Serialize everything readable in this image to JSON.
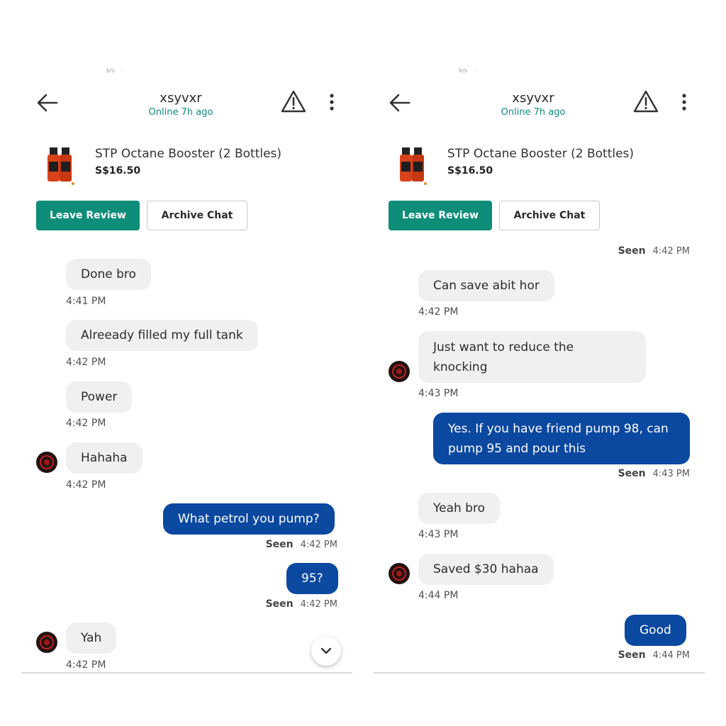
{
  "header": {
    "contact_name": "xsyvxr",
    "status": "Online 7h ago"
  },
  "listing": {
    "name": "STP Octane Booster (2 Bottles)",
    "price": "S$16.50"
  },
  "actions": {
    "leave_review": "Leave Review",
    "archive_chat": "Archive Chat"
  },
  "icons": {
    "back": "arrow-left-icon",
    "report": "warning-triangle-icon",
    "menu": "more-vertical-icon",
    "scroll": "chevron-down-icon"
  },
  "colors": {
    "accent_green": "#0e8e79",
    "outgoing_bubble": "#0b48a0",
    "incoming_bubble": "#f0f0f0"
  },
  "left_panel": {
    "messages": [
      {
        "dir": "in",
        "text": "Done bro",
        "time": "4:41 PM"
      },
      {
        "dir": "in",
        "text": "Alreeady filled my full tank",
        "time": "4:42 PM"
      },
      {
        "dir": "in",
        "text": "Power",
        "time": "4:42 PM"
      },
      {
        "dir": "in",
        "text": "Hahaha",
        "time": "4:42 PM"
      },
      {
        "dir": "out",
        "text": "What petrol you pump?",
        "seen": "Seen",
        "time": "4:42 PM"
      },
      {
        "dir": "out",
        "text": "95?",
        "seen": "Seen",
        "time": "4:42 PM"
      },
      {
        "dir": "in",
        "text": "Yah",
        "time": "4:42 PM"
      }
    ]
  },
  "right_panel": {
    "partial_top": {
      "seen": "Seen",
      "time": "4:42 PM"
    },
    "messages": [
      {
        "dir": "in",
        "text": "Can save abit hor",
        "time": "4:42 PM"
      },
      {
        "dir": "in",
        "text": "Just want to reduce the knocking",
        "time": "4:43 PM"
      },
      {
        "dir": "out",
        "text": "Yes. If you have friend pump 98, can pump 95 and pour this",
        "seen": "Seen",
        "time": "4:43 PM"
      },
      {
        "dir": "in",
        "text": "Yeah bro",
        "time": "4:43 PM"
      },
      {
        "dir": "in",
        "text": "Saved $30 hahaa",
        "time": "4:44 PM"
      },
      {
        "dir": "out",
        "text": "Good",
        "seen": "Seen",
        "time": "4:44 PM"
      }
    ]
  }
}
